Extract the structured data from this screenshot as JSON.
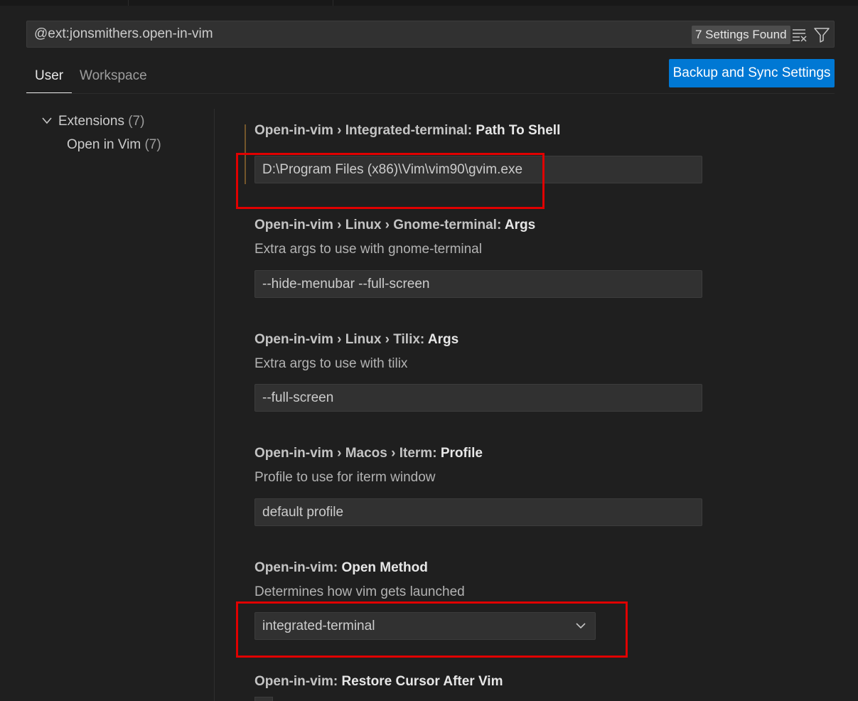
{
  "search": {
    "value": "@ext:jonsmithers.open-in-vim",
    "results_badge": "7 Settings Found"
  },
  "tabs": [
    {
      "label": "User",
      "active": true
    },
    {
      "label": "Workspace",
      "active": false
    }
  ],
  "sync_button": "Backup and Sync Settings",
  "toc": {
    "extensions_label": "Extensions",
    "extensions_count": "(7)",
    "child_label": "Open in Vim",
    "child_count": "(7)"
  },
  "settings": [
    {
      "category": "Open-in-vim › Integrated-terminal: ",
      "key": "Path To Shell",
      "description": "",
      "value": "D:\\Program Files (x86)\\Vim\\vim90\\gvim.exe"
    },
    {
      "category": "Open-in-vim › Linux › Gnome-terminal: ",
      "key": "Args",
      "description": "Extra args to use with gnome-terminal",
      "value": "--hide-menubar --full-screen"
    },
    {
      "category": "Open-in-vim › Linux › Tilix: ",
      "key": "Args",
      "description": "Extra args to use with tilix",
      "value": "--full-screen"
    },
    {
      "category": "Open-in-vim › Macos › Iterm: ",
      "key": "Profile",
      "description": "Profile to use for iterm window",
      "value": "default profile"
    },
    {
      "category": "Open-in-vim: ",
      "key": "Open Method",
      "description": "Determines how vim gets launched",
      "value": "integrated-terminal"
    },
    {
      "category": "Open-in-vim: ",
      "key": "Restore Cursor After Vim",
      "description": "",
      "value": ""
    }
  ],
  "icons": {
    "clear": "clear-filter-icon",
    "filter": "filter-icon",
    "chevron": "chevron-down-icon"
  },
  "colors": {
    "accent": "#0078d4",
    "highlight": "#e00000",
    "modified": "#73562b"
  }
}
